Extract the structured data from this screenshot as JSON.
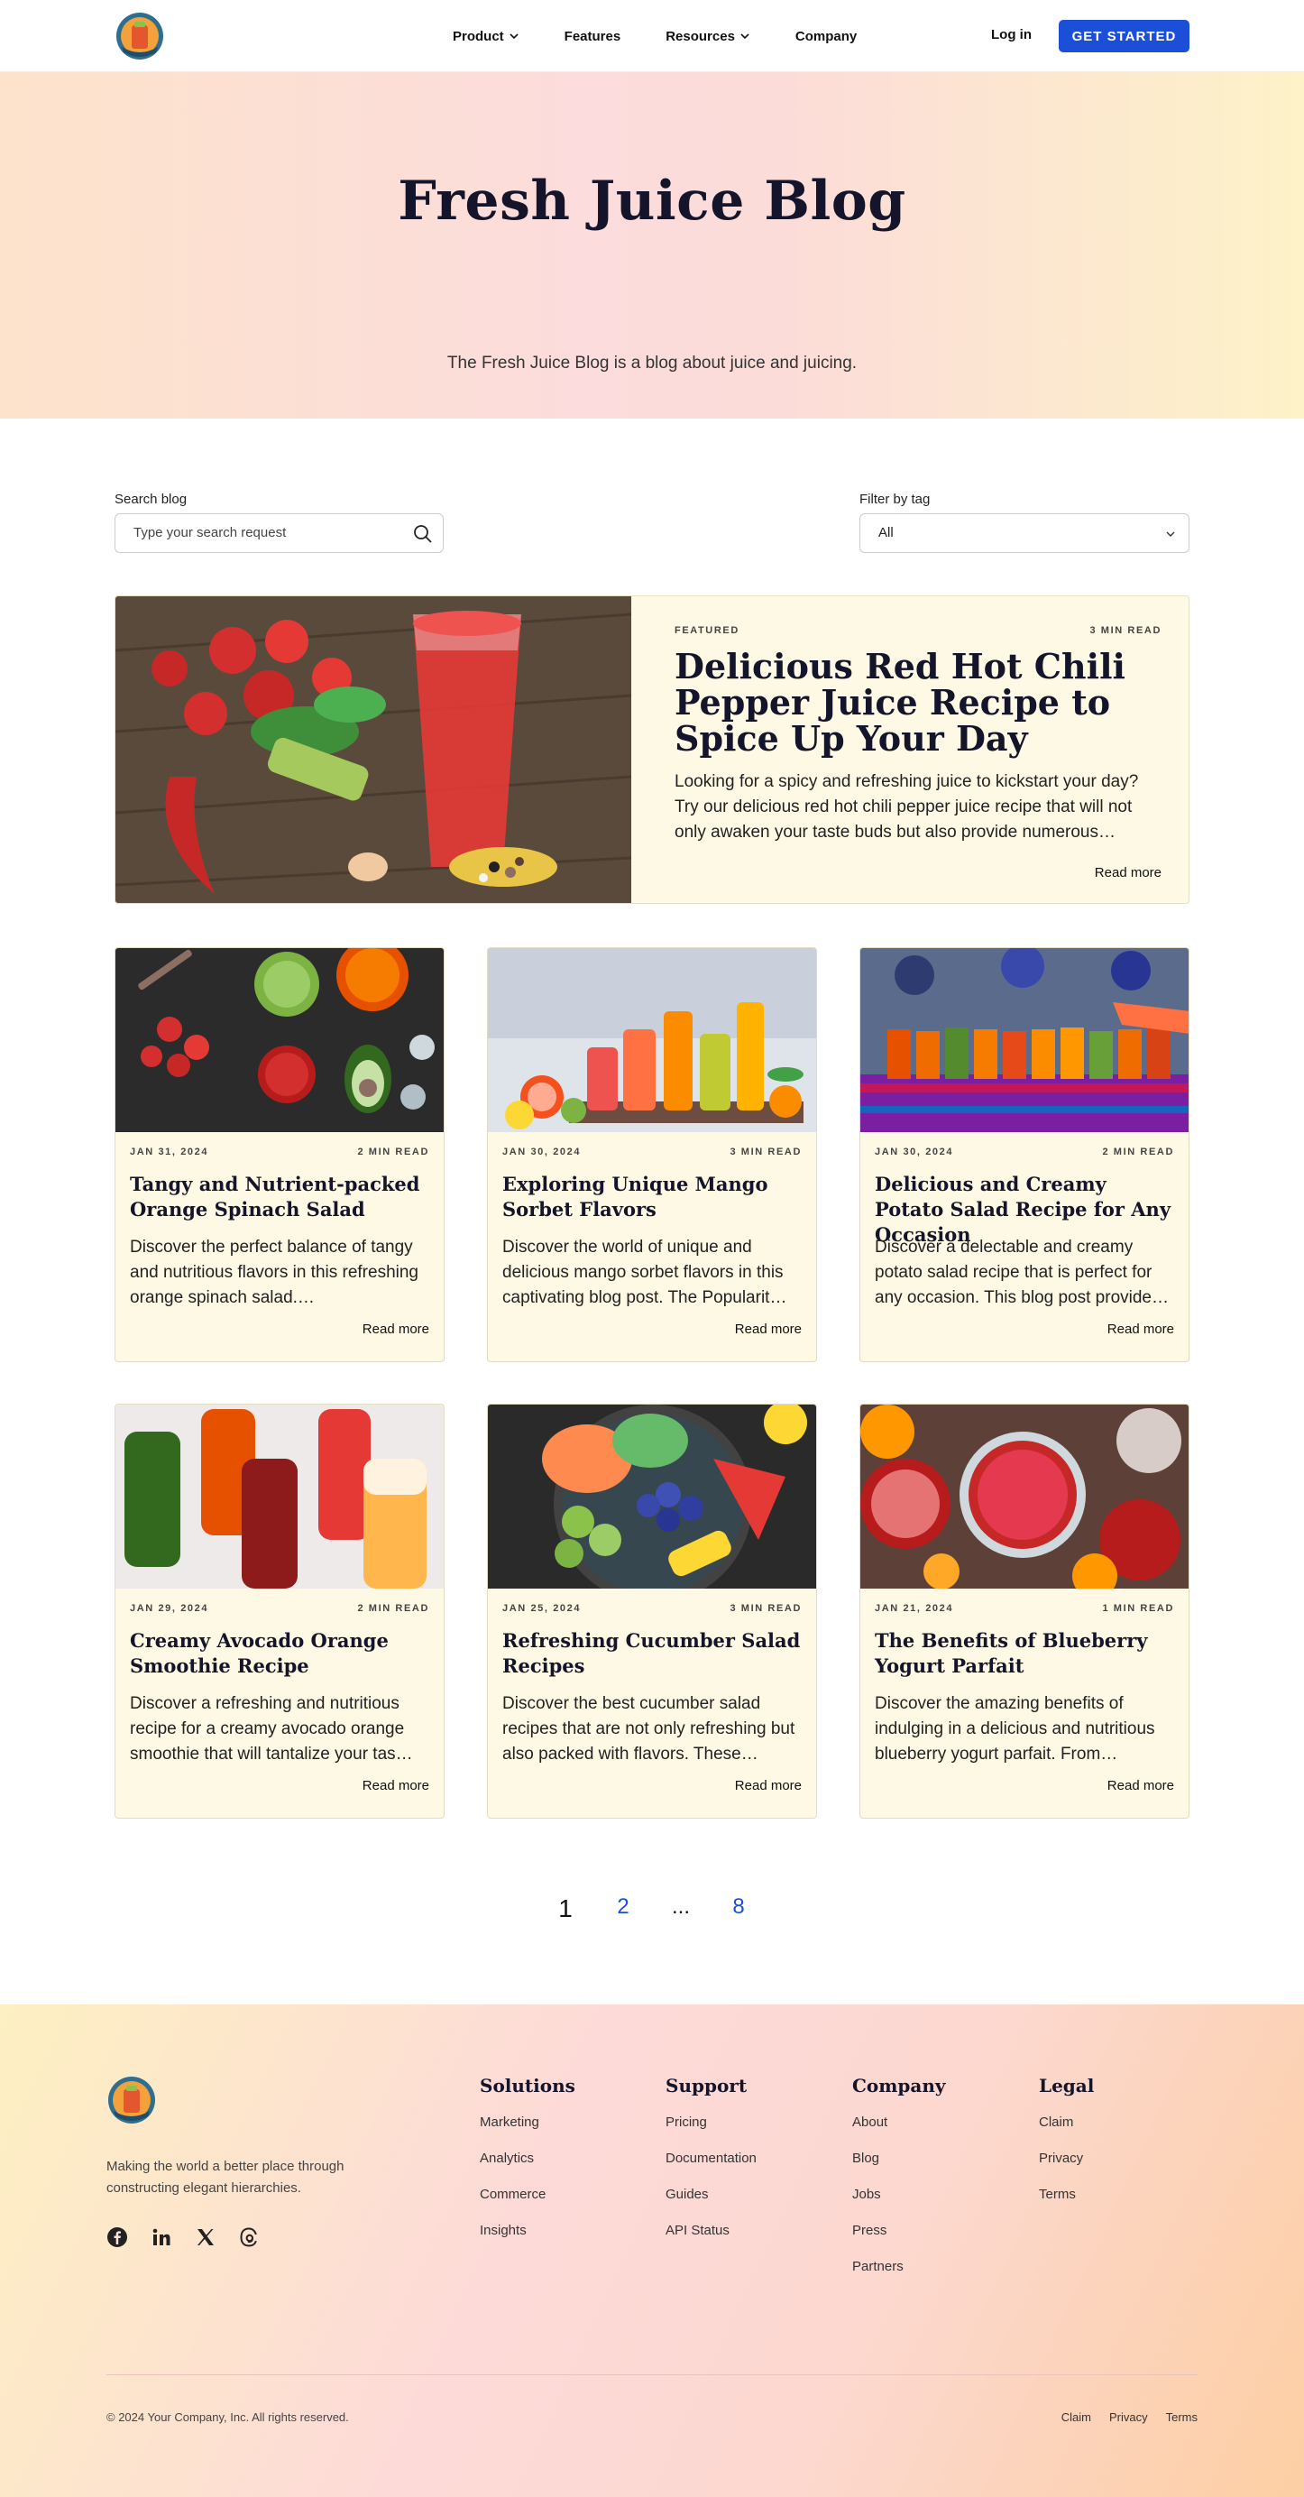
{
  "nav": {
    "links": [
      "Product",
      "Features",
      "Resources",
      "Company"
    ],
    "login": "Log in",
    "cta": "GET STARTED"
  },
  "hero": {
    "title": "Fresh Juice Blog",
    "subtitle": "The Fresh Juice Blog is a blog about juice and juicing."
  },
  "filters": {
    "search_label": "Search blog",
    "search_placeholder": "Type your search request",
    "tag_label": "Filter by tag",
    "tag_value": "All"
  },
  "featured": {
    "label": "FEATURED",
    "read_time": "3 MIN READ",
    "title": "Delicious Red Hot Chili Pepper Juice Recipe to Spice Up Your Day",
    "excerpt": "Looking for a spicy and refreshing juice to kickstart your day? Try our delicious red hot chili pepper juice recipe that will not only awaken your taste buds but also provide numerous…",
    "read_more": "Read more"
  },
  "posts": [
    {
      "date": "JAN 31, 2024",
      "read_time": "2 MIN READ",
      "title": "Tangy and Nutrient-packed Orange Spinach Salad",
      "excerpt": "Discover the perfect balance of tangy and nutritious flavors in this refreshing orange spinach salad.…",
      "read_more": "Read more"
    },
    {
      "date": "JAN 30, 2024",
      "read_time": "3 MIN READ",
      "title": "Exploring Unique Mango Sorbet Flavors",
      "excerpt": "Discover the world of unique and delicious mango sorbet flavors in this captivating blog post. The Popularit…",
      "read_more": "Read more"
    },
    {
      "date": "JAN 30, 2024",
      "read_time": "2 MIN READ",
      "title": "Delicious and Creamy Potato Salad Recipe for Any Occasion",
      "excerpt": "Discover a delectable and creamy potato salad recipe that is perfect for any occasion. This blog post provide…",
      "read_more": "Read more"
    },
    {
      "date": "JAN 29, 2024",
      "read_time": "2 MIN READ",
      "title": "Creamy Avocado Orange Smoothie Recipe",
      "excerpt": "Discover a refreshing and nutritious recipe for a creamy avocado orange smoothie that will tantalize your tas…",
      "read_more": "Read more"
    },
    {
      "date": "JAN 25, 2024",
      "read_time": "3 MIN READ",
      "title": "Refreshing Cucumber Salad Recipes",
      "excerpt": "Discover the best cucumber salad recipes that are not only refreshing but also packed with flavors. These…",
      "read_more": "Read more"
    },
    {
      "date": "JAN 21, 2024",
      "read_time": "1 MIN READ",
      "title": "The Benefits of Blueberry Yogurt Parfait",
      "excerpt": "Discover the amazing benefits of indulging in a delicious and nutritious blueberry yogurt parfait. From…",
      "read_more": "Read more"
    }
  ],
  "pagination": {
    "current": "1",
    "next": "2",
    "dots": "...",
    "last": "8"
  },
  "footer": {
    "tagline": "Making the world a better place through constructing elegant hierarchies.",
    "social_icons": [
      "facebook-icon",
      "linkedin-icon",
      "x-icon",
      "threads-icon"
    ],
    "columns": [
      {
        "title": "Solutions",
        "links": [
          "Marketing",
          "Analytics",
          "Commerce",
          "Insights"
        ]
      },
      {
        "title": "Support",
        "links": [
          "Pricing",
          "Documentation",
          "Guides",
          "API Status"
        ]
      },
      {
        "title": "Company",
        "links": [
          "About",
          "Blog",
          "Jobs",
          "Press",
          "Partners"
        ]
      },
      {
        "title": "Legal",
        "links": [
          "Claim",
          "Privacy",
          "Terms"
        ]
      }
    ],
    "copyright": "© 2024 Your Company, Inc. All rights reserved.",
    "legal_links": [
      "Claim",
      "Privacy",
      "Terms"
    ]
  },
  "colors": {
    "accent": "#1d4ed8",
    "card_bg": "#fef9e4",
    "heading": "#14142b"
  }
}
